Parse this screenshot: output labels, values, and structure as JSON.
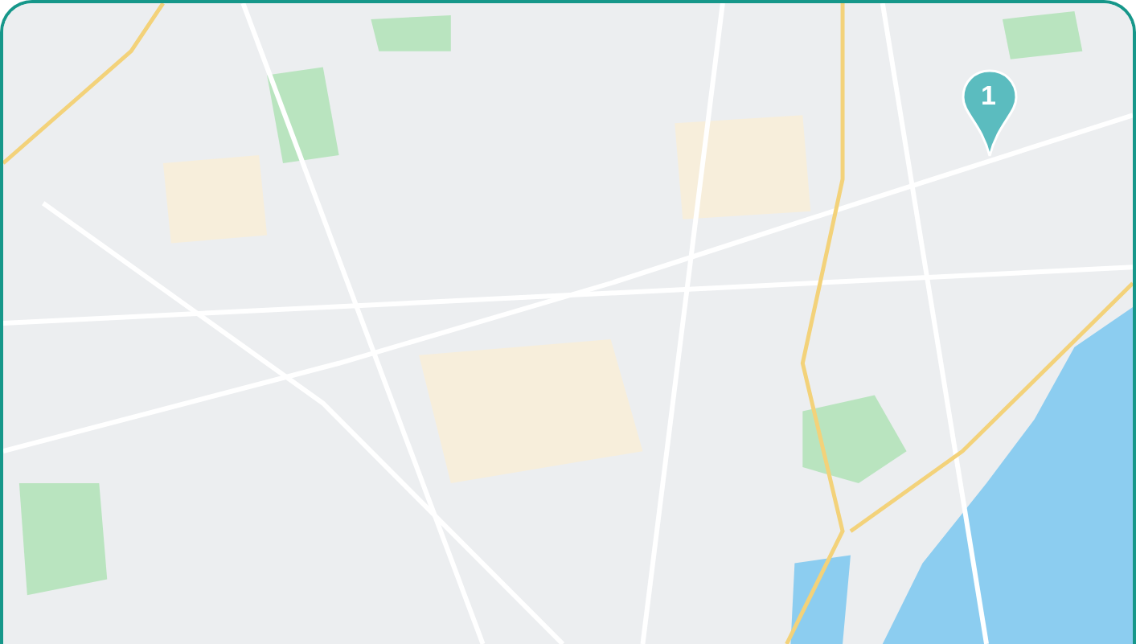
{
  "map": {
    "marker": {
      "label": "1"
    }
  }
}
